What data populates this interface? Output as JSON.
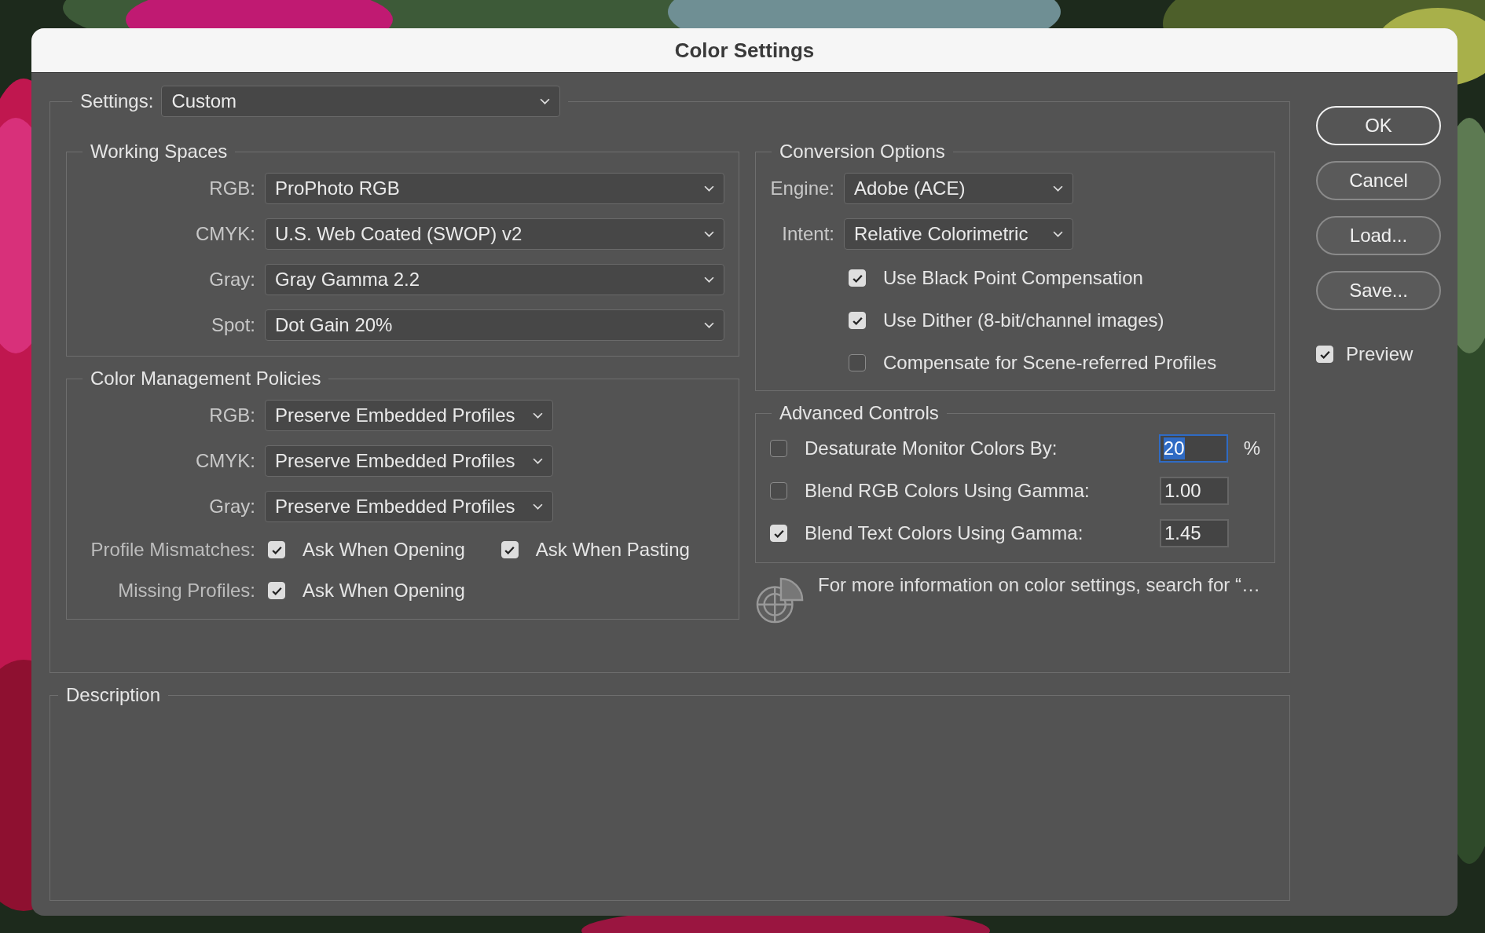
{
  "window": {
    "title": "Color Settings"
  },
  "settings": {
    "label": "Settings:",
    "value": "Custom"
  },
  "working_spaces": {
    "title": "Working Spaces",
    "rows": [
      {
        "label": "RGB:",
        "value": "ProPhoto RGB"
      },
      {
        "label": "CMYK:",
        "value": "U.S. Web Coated (SWOP) v2"
      },
      {
        "label": "Gray:",
        "value": "Gray Gamma 2.2"
      },
      {
        "label": "Spot:",
        "value": "Dot Gain 20%"
      }
    ]
  },
  "policies": {
    "title": "Color Management Policies",
    "rows": [
      {
        "label": "RGB:",
        "value": "Preserve Embedded Profiles"
      },
      {
        "label": "CMYK:",
        "value": "Preserve Embedded Profiles"
      },
      {
        "label": "Gray:",
        "value": "Preserve Embedded Profiles"
      }
    ],
    "checks": [
      {
        "label": "Profile Mismatches:",
        "options": [
          {
            "label": "Ask When Opening",
            "checked": true
          },
          {
            "label": "Ask When Pasting",
            "checked": true
          }
        ]
      },
      {
        "label": "Missing Profiles:",
        "options": [
          {
            "label": "Ask When Opening",
            "checked": true
          }
        ]
      }
    ]
  },
  "conversion": {
    "title": "Conversion Options",
    "selects": [
      {
        "label": "Engine:",
        "value": "Adobe (ACE)"
      },
      {
        "label": "Intent:",
        "value": "Relative Colorimetric"
      }
    ],
    "options": [
      {
        "label": "Use Black Point Compensation",
        "checked": true
      },
      {
        "label": "Use Dither (8-bit/channel images)",
        "checked": true
      },
      {
        "label": "Compensate for Scene-referred Profiles",
        "checked": false
      }
    ]
  },
  "advanced": {
    "title": "Advanced Controls",
    "rows": [
      {
        "label": "Desaturate Monitor Colors By:",
        "checked": false,
        "value": "20",
        "selected": true,
        "unit": "%"
      },
      {
        "label": "Blend RGB Colors Using Gamma:",
        "checked": false,
        "value": "1.00",
        "selected": false
      },
      {
        "label": "Blend Text Colors Using Gamma:",
        "checked": true,
        "value": "1.45",
        "selected": false
      }
    ]
  },
  "info": "For more information on color settings, search for “…",
  "buttons": [
    {
      "label": "OK",
      "default": true
    },
    {
      "label": "Cancel",
      "default": false
    },
    {
      "label": "Load...",
      "default": false
    },
    {
      "label": "Save...",
      "default": false
    }
  ],
  "preview": {
    "label": "Preview",
    "checked": true
  },
  "description": {
    "title": "Description"
  }
}
